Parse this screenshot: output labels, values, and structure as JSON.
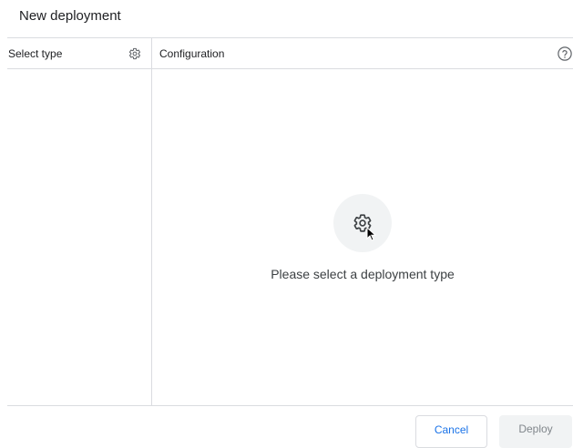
{
  "dialog": {
    "title": "New deployment"
  },
  "left_pane": {
    "title": "Select type",
    "settings_icon": "gear-icon"
  },
  "right_pane": {
    "title": "Configuration",
    "help_icon": "help-circle-icon",
    "empty_state": {
      "icon": "gear-icon",
      "message": "Please select a deployment type"
    }
  },
  "footer": {
    "cancel_label": "Cancel",
    "deploy_label": "Deploy"
  },
  "colors": {
    "accent": "#1a73e8",
    "divider": "#dadce0",
    "disabled_bg": "#f1f3f4",
    "disabled_text": "#80868b"
  }
}
